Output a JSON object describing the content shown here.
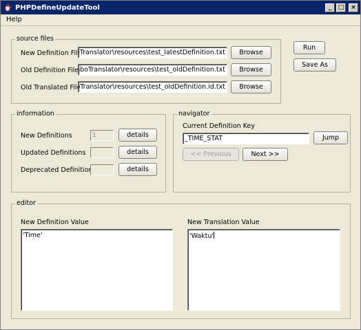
{
  "window": {
    "title": "PHPDefineUpdateTool",
    "minimize": "_",
    "maximize": "□",
    "close": "×"
  },
  "menu": {
    "help": "Help"
  },
  "source_files": {
    "legend": "source files",
    "new_def_label": "New Definition File",
    "new_def_value": "amboTranslator\\resources\\test_latestDefinition.txt",
    "old_def_label": "Old Definition File",
    "old_def_value": "\\MamboTranslator\\resources\\test_oldDefinition.txt",
    "old_trans_label": "Old Translated File",
    "old_trans_value": "amboTranslator\\resources\\test_oldDefinition.id.txt",
    "browse": "Browse"
  },
  "actions": {
    "run": "Run",
    "save_as": "Save As"
  },
  "information": {
    "legend": "information",
    "new_defs_label": "New Definitions",
    "new_defs_value": "1",
    "updated_defs_label": "Updated Definitions",
    "updated_defs_value": "",
    "deprecated_defs_label": "Deprecated Definitions",
    "deprecated_defs_value": "",
    "details": "details"
  },
  "navigator": {
    "legend": "navigator",
    "current_key_label": "Current Definition Key",
    "current_key_value": "_TIME_STAT",
    "jump": "Jump",
    "previous": "<< Previous",
    "next": "Next >>"
  },
  "editor": {
    "legend": "editor",
    "new_def_value_label": "New Definition Value",
    "new_def_value_text": "'Time'",
    "new_trans_value_label": "New Translation Value",
    "new_trans_value_text": "'Waktu'"
  }
}
